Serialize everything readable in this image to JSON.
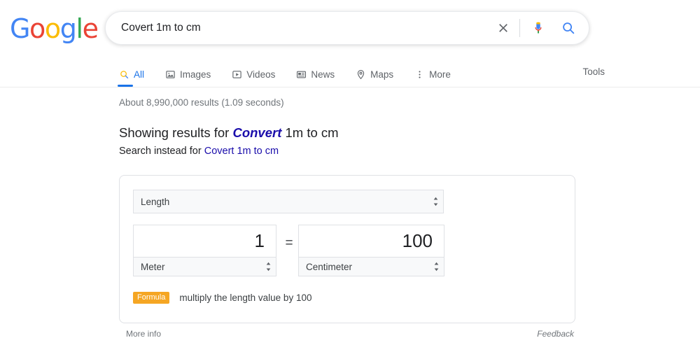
{
  "brand": {
    "name": "Google",
    "letters": [
      {
        "ch": "G",
        "color": "#4285F4"
      },
      {
        "ch": "o",
        "color": "#EA4335"
      },
      {
        "ch": "o",
        "color": "#FBBC05"
      },
      {
        "ch": "g",
        "color": "#4285F4"
      },
      {
        "ch": "l",
        "color": "#34A853"
      },
      {
        "ch": "e",
        "color": "#EA4335"
      }
    ]
  },
  "search": {
    "query": "Covert 1m to cm",
    "placeholder": "Search",
    "clear_icon": "close-icon",
    "mic_icon": "microphone-icon",
    "search_icon": "search-icon"
  },
  "nav": {
    "tabs": [
      {
        "label": "All",
        "icon": "search-icon",
        "active": true
      },
      {
        "label": "Images",
        "icon": "image-icon",
        "active": false
      },
      {
        "label": "Videos",
        "icon": "video-icon",
        "active": false
      },
      {
        "label": "News",
        "icon": "news-icon",
        "active": false
      },
      {
        "label": "Maps",
        "icon": "map-pin-icon",
        "active": false
      },
      {
        "label": "More",
        "icon": "more-vertical-icon",
        "active": false
      }
    ],
    "tools_label": "Tools"
  },
  "results": {
    "stats": "About 8,990,000 results (1.09 seconds)",
    "showing_prefix": "Showing results for ",
    "showing_correction": "Convert",
    "showing_suffix": " 1m to cm",
    "instead_prefix": "Search instead for ",
    "instead_link": "Covert 1m to cm"
  },
  "converter": {
    "category": "Length",
    "from": {
      "value": "1",
      "unit": "Meter"
    },
    "equals": "=",
    "to": {
      "value": "100",
      "unit": "Centimeter"
    },
    "formula_badge": "Formula",
    "formula_text": "multiply the length value by 100",
    "more_info": "More info",
    "feedback": "Feedback",
    "accent_color": "#F5A623",
    "link_color": "#1a0dab"
  }
}
